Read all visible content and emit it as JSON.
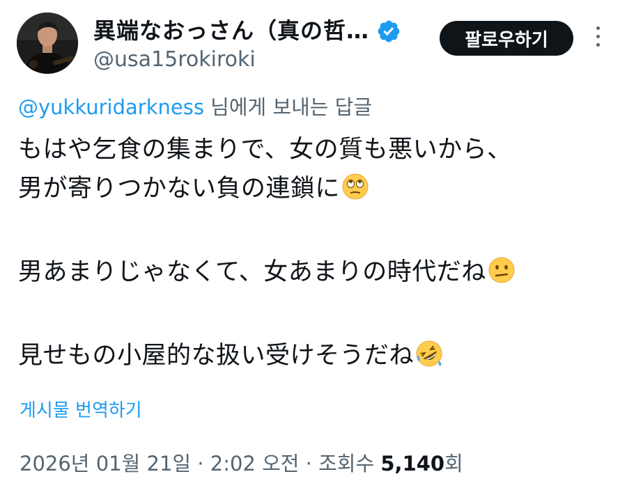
{
  "header": {
    "display_name": "異端なおっさん（真の哲…",
    "handle": "@usa15rokiroki",
    "follow_label": "팔로우하기"
  },
  "reply": {
    "mention": "@yukkuridarkness",
    "suffix": " 님에게 보내는 답글"
  },
  "tweet": {
    "line1": "もはや乞食の集まりで、女の質も悪いから、",
    "line2": "男が寄りつかない負の連鎖に",
    "line3": "男あまりじゃなくて、女あまりの時代だね",
    "line4": "見せもの小屋的な扱い受けそうだね",
    "emoji1": "face-with-rolling-eyes",
    "emoji2": "confused-face",
    "emoji3": "rolling-on-the-floor-laughing"
  },
  "translate_label": "게시물 번역하기",
  "meta": {
    "date": "2026년 01월 21일",
    "sep1": " · ",
    "time": "2:02 오전",
    "sep2": " · ",
    "views_label": "조회수 ",
    "views_count": "5,140",
    "views_suffix": "회"
  },
  "colors": {
    "link": "#1d9bf0",
    "secondary": "#536471",
    "text": "#0f1419",
    "button_bg": "#0f1419"
  }
}
